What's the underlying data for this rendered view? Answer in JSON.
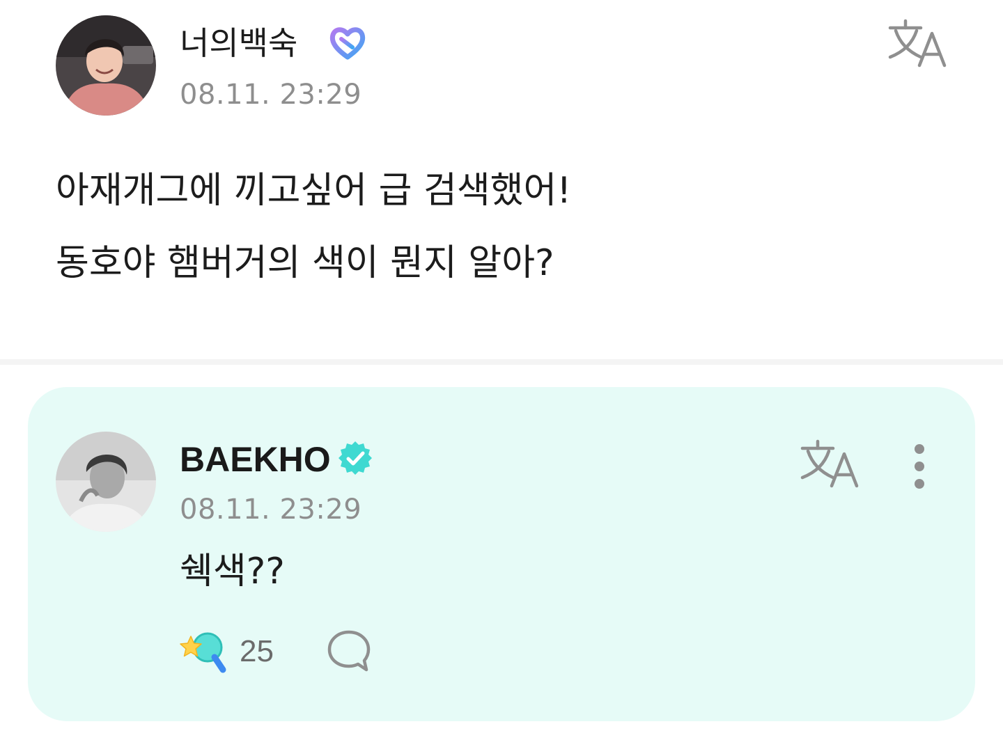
{
  "post": {
    "author": "너의백숙",
    "author_badge_icon": "fan-heart-badge-icon",
    "timestamp": "08.11. 23:29",
    "translate_icon": "translate-icon",
    "body_lines": [
      "아재개그에 끼고싶어 급 검색했어!",
      "동호야 햄버거의 색이 뭔지 알아?"
    ]
  },
  "reply": {
    "author": "BAEKHO",
    "verified_icon": "verified-check-icon",
    "timestamp": "08.11. 23:29",
    "translate_icon": "translate-icon",
    "more_icon": "more-vertical-icon",
    "text": "쉑색??",
    "like_count": "25",
    "like_icon": "star-wand-like-icon",
    "comment_icon": "comment-bubble-icon"
  },
  "colors": {
    "reply_background": "#e6fbf7",
    "timestamp": "#8e8e8e",
    "verified": "#3fd9d1",
    "fan_badge_start": "#a57cf2",
    "fan_badge_end": "#4aa8f2",
    "icon_gray": "#8f8f8f"
  }
}
